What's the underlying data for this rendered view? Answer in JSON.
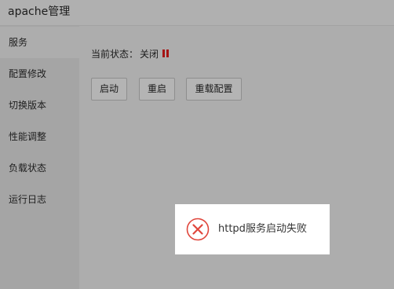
{
  "window": {
    "title": "apache管理"
  },
  "sidebar": {
    "items": [
      {
        "label": "服务",
        "active": true
      },
      {
        "label": "配置修改",
        "active": false
      },
      {
        "label": "切换版本",
        "active": false
      },
      {
        "label": "性能调整",
        "active": false
      },
      {
        "label": "负载状态",
        "active": false
      },
      {
        "label": "运行日志",
        "active": false
      }
    ]
  },
  "main": {
    "status_label": "当前状态：",
    "status_value": "关闭",
    "status_icon": "pause-icon",
    "status_color": "#a51414",
    "buttons": {
      "start": "启动",
      "restart": "重启",
      "reload": "重载配置"
    }
  },
  "toast": {
    "icon": "error-circle-icon",
    "icon_color": "#e0463c",
    "message": "httpd服务启动失败"
  }
}
